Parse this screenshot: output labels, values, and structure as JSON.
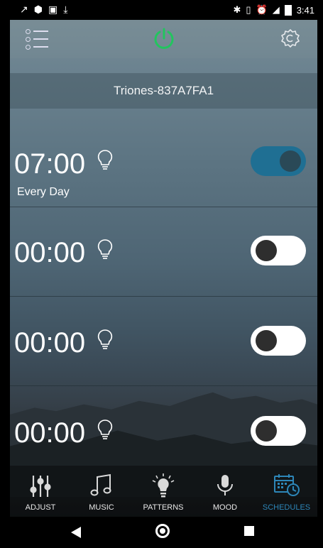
{
  "status_bar": {
    "left_icons": [
      "signal-warning-icon",
      "app-icon",
      "image-icon",
      "download-icon"
    ],
    "right_icons": [
      "bluetooth-icon",
      "vibrate-icon",
      "alarm-icon",
      "lte-signal-icon",
      "battery-icon"
    ],
    "time": "3:41"
  },
  "header": {
    "menu_icon": "menu-list-icon",
    "power_icon": "power-icon",
    "power_color": "#22c55e",
    "settings_icon": "gear-icon"
  },
  "device": {
    "name": "Triones-837A7FA1"
  },
  "schedules": [
    {
      "time": "07:00",
      "repeat": "Every Day",
      "enabled": true
    },
    {
      "time": "00:00",
      "repeat": "",
      "enabled": false
    },
    {
      "time": "00:00",
      "repeat": "",
      "enabled": false
    },
    {
      "time": "00:00",
      "repeat": "",
      "enabled": false
    }
  ],
  "tabs": [
    {
      "label": "ADJUST",
      "icon": "sliders-icon",
      "active": false
    },
    {
      "label": "MUSIC",
      "icon": "music-note-icon",
      "active": false
    },
    {
      "label": "PATTERNS",
      "icon": "bulb-rays-icon",
      "active": false
    },
    {
      "label": "MOOD",
      "icon": "microphone-icon",
      "active": false
    },
    {
      "label": "SCHEDULES",
      "icon": "calendar-clock-icon",
      "active": true
    }
  ],
  "colors": {
    "accent": "#2d86b8",
    "toggle_on": "#1f6f93"
  }
}
